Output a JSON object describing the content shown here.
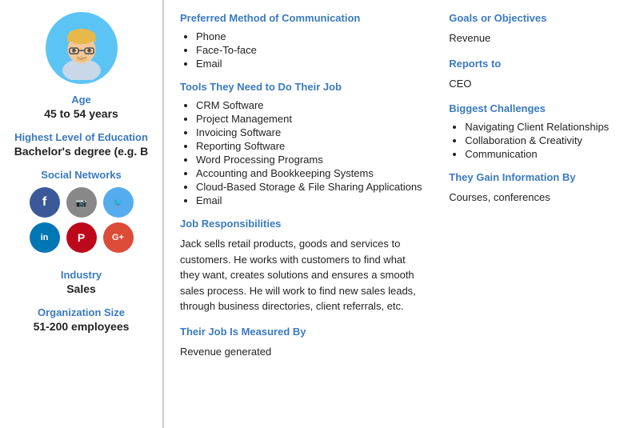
{
  "sidebar": {
    "age_label": "Age",
    "age_value": "45 to 54 years",
    "education_label": "Highest Level of Education",
    "education_value": "Bachelor's degree (e.g. B",
    "social_label": "Social Networks",
    "social_icons": [
      {
        "name": "facebook",
        "class": "si-facebook",
        "symbol": "f"
      },
      {
        "name": "instagram",
        "class": "si-instagram",
        "symbol": "📷"
      },
      {
        "name": "twitter",
        "class": "si-twitter",
        "symbol": "🐦"
      },
      {
        "name": "linkedin",
        "class": "si-linkedin",
        "symbol": "in"
      },
      {
        "name": "pinterest",
        "class": "si-pinterest",
        "symbol": "P"
      },
      {
        "name": "gplus",
        "class": "si-gplus",
        "symbol": "G+"
      }
    ],
    "industry_label": "Industry",
    "industry_value": "Sales",
    "org_size_label": "Organization Size",
    "org_size_value": "51-200 employees"
  },
  "main": {
    "left": {
      "comm_title": "Preferred Method of Communication",
      "comm_items": [
        "Phone",
        "Face-To-face",
        "Email"
      ],
      "tools_title": "Tools They Need to Do Their Job",
      "tools_items": [
        "CRM Software",
        "Project Management",
        "Invoicing Software",
        "Reporting Software",
        "Word Processing Programs",
        "Accounting and Bookkeeping Systems",
        "Cloud-Based Storage & File Sharing Applications",
        "Email"
      ],
      "job_resp_title": "Job Responsibilities",
      "job_resp_text": "Jack sells retail products, goods and services to customers. He works with customers to find what they want, creates solutions and ensures a smooth sales process. He will work to find new sales leads, through business directories, client referrals, etc.",
      "measured_title": "Their Job Is Measured By",
      "measured_text": "Revenue generated"
    },
    "right": {
      "goals_title": "Goals or Objectives",
      "goals_text": "Revenue",
      "reports_title": "Reports to",
      "reports_text": "CEO",
      "challenges_title": "Biggest Challenges",
      "challenges_items": [
        "Navigating Client Relationships",
        "Collaboration & Creativity",
        "Communication"
      ],
      "info_title": "They Gain Information By",
      "info_text": "Courses, conferences"
    }
  }
}
